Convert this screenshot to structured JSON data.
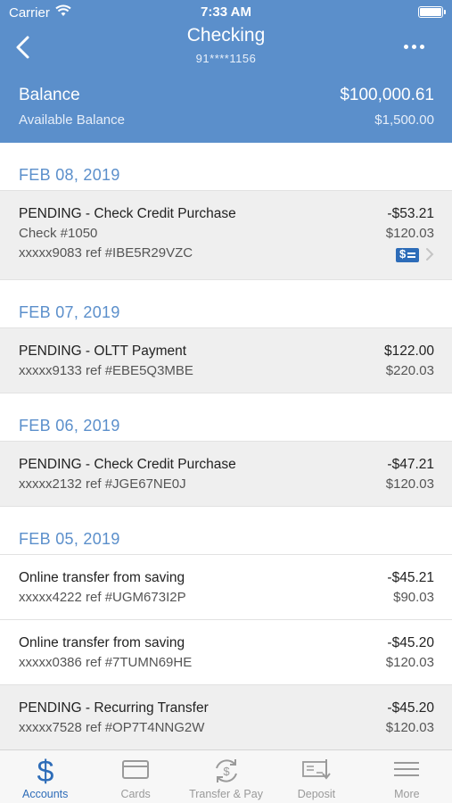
{
  "status_bar": {
    "carrier": "Carrier",
    "time": "7:33 AM"
  },
  "nav": {
    "title": "Checking",
    "account_number": "91****1156"
  },
  "balance": {
    "label": "Balance",
    "value": "$100,000.61",
    "available_label": "Available Balance",
    "available_value": "$1,500.00"
  },
  "groups": [
    {
      "date": "FEB 08, 2019",
      "transactions": [
        {
          "description": "PENDING - Check Credit Purchase",
          "check": "Check #1050",
          "ref": "xxxxx9083 ref #IBE5R29VZC",
          "amount": "-$53.21",
          "balance": "$120.03",
          "pending": true,
          "has_check_image": true
        }
      ]
    },
    {
      "date": "FEB 07, 2019",
      "transactions": [
        {
          "description": "PENDING - OLTT Payment",
          "ref": "xxxxx9133 ref #EBE5Q3MBE",
          "amount": "$122.00",
          "balance": "$220.03",
          "pending": true
        }
      ]
    },
    {
      "date": "FEB 06, 2019",
      "transactions": [
        {
          "description": "PENDING - Check Credit Purchase",
          "ref": "xxxxx2132 ref #JGE67NE0J",
          "amount": "-$47.21",
          "balance": "$120.03",
          "pending": true
        }
      ]
    },
    {
      "date": "FEB 05, 2019",
      "transactions": [
        {
          "description": "Online transfer from saving",
          "ref": "xxxxx4222 ref #UGM673I2P",
          "amount": "-$45.21",
          "balance": "$90.03",
          "pending": false
        },
        {
          "description": "Online transfer from saving",
          "ref": "xxxxx0386 ref #7TUMN69HE",
          "amount": "-$45.20",
          "balance": "$120.03",
          "pending": false
        },
        {
          "description": "PENDING - Recurring Transfer",
          "ref": "xxxxx7528 ref #OP7T4NNG2W",
          "amount": "-$45.20",
          "balance": "$120.03",
          "pending": true
        }
      ]
    }
  ],
  "tabs": [
    {
      "label": "Accounts",
      "icon": "dollar-icon",
      "active": true
    },
    {
      "label": "Cards",
      "icon": "card-icon",
      "active": false
    },
    {
      "label": "Transfer & Pay",
      "icon": "transfer-icon",
      "active": false
    },
    {
      "label": "Deposit",
      "icon": "deposit-icon",
      "active": false
    },
    {
      "label": "More",
      "icon": "menu-icon",
      "active": false
    }
  ],
  "colors": {
    "header": "#5b8fcb",
    "accent": "#2d6cb8",
    "pending_row": "#efefef"
  }
}
